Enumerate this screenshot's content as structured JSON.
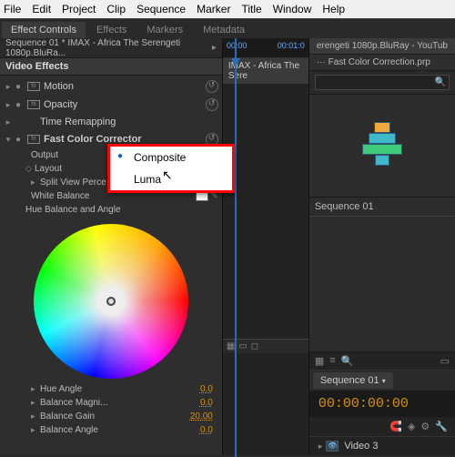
{
  "menu": {
    "file": "File",
    "edit": "Edit",
    "project": "Project",
    "clip": "Clip",
    "sequence": "Sequence",
    "marker": "Marker",
    "title": "Title",
    "window": "Window",
    "help": "Help"
  },
  "tabs": {
    "effect_controls": "Effect Controls",
    "effects": "Effects",
    "markers": "Markers",
    "metadata": "Metadata"
  },
  "sequence_path": "Sequence 01 * IMAX - Africa The Serengeti 1080p.BluRa...",
  "video_effects_header": "Video Effects",
  "fx": {
    "motion": "Motion",
    "opacity": "Opacity",
    "time_remapping": "Time Remapping",
    "fast_color": "Fast Color Corrector"
  },
  "params": {
    "output": "Output",
    "layout": "Layout",
    "split_view": "Split View Perce",
    "white_balance": "White Balance",
    "hue_balance": "Hue Balance and Angle",
    "hue_angle": "Hue Angle",
    "hue_angle_v": "0.0",
    "balance_magni": "Balance Magni...",
    "balance_magni_v": "0.0",
    "balance_gain": "Balance Gain",
    "balance_gain_v": "20.00",
    "balance_angle": "Balance Angle",
    "balance_angle_v": "0.0"
  },
  "dropdown": {
    "composite": "Composite",
    "luma": "Luma"
  },
  "mid": {
    "t0": "00:00",
    "t1": "00:01:0",
    "seq_tab": "IMAX - Africa The Sere"
  },
  "right": {
    "header": "erengeti 1080p.BluRay - YouTub",
    "fx_title": "··· Fast Color Correction.prp",
    "search_ph": "",
    "sequence_label": "Sequence 01"
  },
  "bottom": {
    "seq_tab": "Sequence 01",
    "timecode": "00:00:00:00",
    "track": "Video 3"
  }
}
